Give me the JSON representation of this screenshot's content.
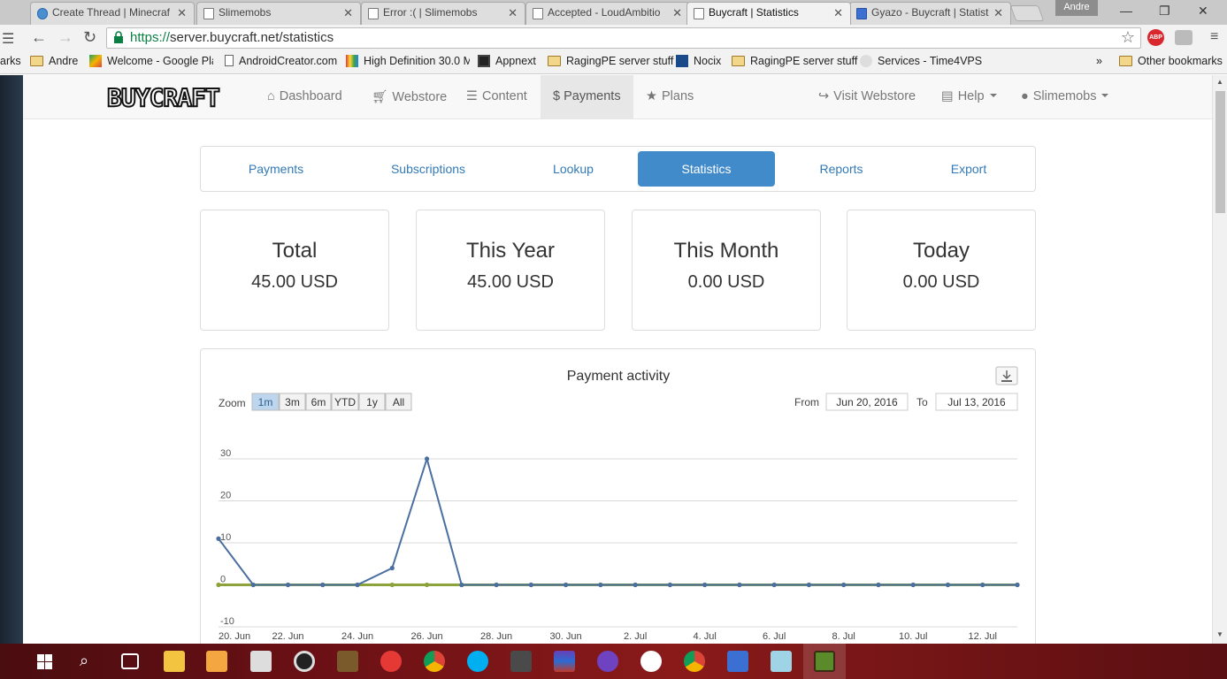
{
  "browser": {
    "tabs": [
      {
        "title": "Create Thread | Minecraf",
        "icon": "minecraft-forum-icon"
      },
      {
        "title": "Slimemobs",
        "icon": "page-icon"
      },
      {
        "title": "Error :( | Slimemobs",
        "icon": "page-icon"
      },
      {
        "title": "Accepted - LoudAmbitio",
        "icon": "page-icon"
      },
      {
        "title": "Buycraft | Statistics",
        "icon": "page-icon",
        "active": true
      },
      {
        "title": "Gyazo - Buycraft | Statist",
        "icon": "gyazo-icon"
      }
    ],
    "profile_name": "Andre",
    "url_scheme": "https://",
    "url_rest": "server.buycraft.net/statistics",
    "extension_label": "ABP",
    "bookmarks": [
      {
        "label": "arks",
        "icon": "none"
      },
      {
        "label": "Andre",
        "icon": "folder"
      },
      {
        "label": "Welcome - Google Pla",
        "icon": "google-play-icon"
      },
      {
        "label": "AndroidCreator.com",
        "icon": "page-icon"
      },
      {
        "label": "High Definition 30.0 M",
        "icon": "hd-icon"
      },
      {
        "label": "Appnext",
        "icon": "appnext-icon"
      },
      {
        "label": "RagingPE server stuff",
        "icon": "folder"
      },
      {
        "label": "Nocix",
        "icon": "nocix-icon"
      },
      {
        "label": "RagingPE server stuff",
        "icon": "folder"
      },
      {
        "label": "Services - Time4VPS",
        "icon": "time4vps-icon"
      }
    ],
    "bookmarks_overflow": "»",
    "other_bookmarks": "Other bookmarks"
  },
  "site": {
    "logo_text": "BUYCRAFT",
    "nav": {
      "dashboard": "Dashboard",
      "webstore": "Webstore",
      "content": "Content",
      "payments": "$ Payments",
      "plans": "Plans",
      "visit_webstore": "Visit Webstore",
      "help": "Help",
      "user": "Slimemobs"
    },
    "subnav": [
      "Payments",
      "Subscriptions",
      "Lookup",
      "Statistics",
      "Reports",
      "Export"
    ],
    "subnav_active": "Statistics",
    "stats": [
      {
        "label": "Total",
        "value": "45.00 USD"
      },
      {
        "label": "This Year",
        "value": "45.00 USD"
      },
      {
        "label": "This Month",
        "value": "0.00 USD"
      },
      {
        "label": "Today",
        "value": "0.00 USD"
      }
    ]
  },
  "chart_ui": {
    "zoom_label": "Zoom",
    "zoom_buttons": [
      "1m",
      "3m",
      "6m",
      "YTD",
      "1y",
      "All"
    ],
    "zoom_active": "1m",
    "from_label": "From",
    "from_value": "Jun 20, 2016",
    "to_label": "To",
    "to_value": "Jul 13, 2016"
  },
  "chart_data": {
    "type": "line",
    "title": "Payment activity",
    "xlabel": "",
    "ylabel": "",
    "ylim": [
      -10,
      30
    ],
    "yticks": [
      -10,
      0,
      10,
      20,
      30
    ],
    "grid": true,
    "x": [
      "20. Jun",
      "21. Jun",
      "22. Jun",
      "23. Jun",
      "24. Jun",
      "25. Jun",
      "26. Jun",
      "27. Jun",
      "28. Jun",
      "29. Jun",
      "30. Jun",
      "1. Jul",
      "2. Jul",
      "3. Jul",
      "4. Jul",
      "5. Jul",
      "6. Jul",
      "7. Jul",
      "8. Jul",
      "9. Jul",
      "10. Jul",
      "11. Jul",
      "12. Jul",
      "13. Jul"
    ],
    "xtick_labels": [
      "20. Jun",
      "22. Jun",
      "24. Jun",
      "26. Jun",
      "28. Jun",
      "30. Jun",
      "2. Jul",
      "4. Jul",
      "6. Jul",
      "8. Jul",
      "10. Jul",
      "12. Jul"
    ],
    "series": [
      {
        "color": "#4a6fa0",
        "values": [
          11,
          0,
          0,
          0,
          0,
          4,
          30,
          0,
          0,
          0,
          0,
          0,
          0,
          0,
          0,
          0,
          0,
          0,
          0,
          0,
          0,
          0,
          0,
          0
        ]
      },
      {
        "color": "#8ba33a",
        "values": [
          0,
          0,
          0,
          0,
          0,
          0,
          0,
          0,
          0,
          0,
          0,
          0,
          0,
          0,
          0,
          0,
          0,
          0,
          0,
          0,
          0,
          0,
          0,
          0
        ]
      }
    ]
  },
  "taskbar_icons": [
    "start-icon",
    "search-icon",
    "task-view-icon",
    "file-explorer-icon",
    "media-player-icon",
    "store-icon",
    "record-icon",
    "minecraft-icon",
    "screenshot-icon",
    "chrome-icon",
    "skype-icon",
    "app-icon",
    "winrar-icon",
    "github-icon",
    "slack-icon",
    "chrome-icon",
    "network-icon",
    "notepad-icon",
    "minecraft-block-icon"
  ]
}
